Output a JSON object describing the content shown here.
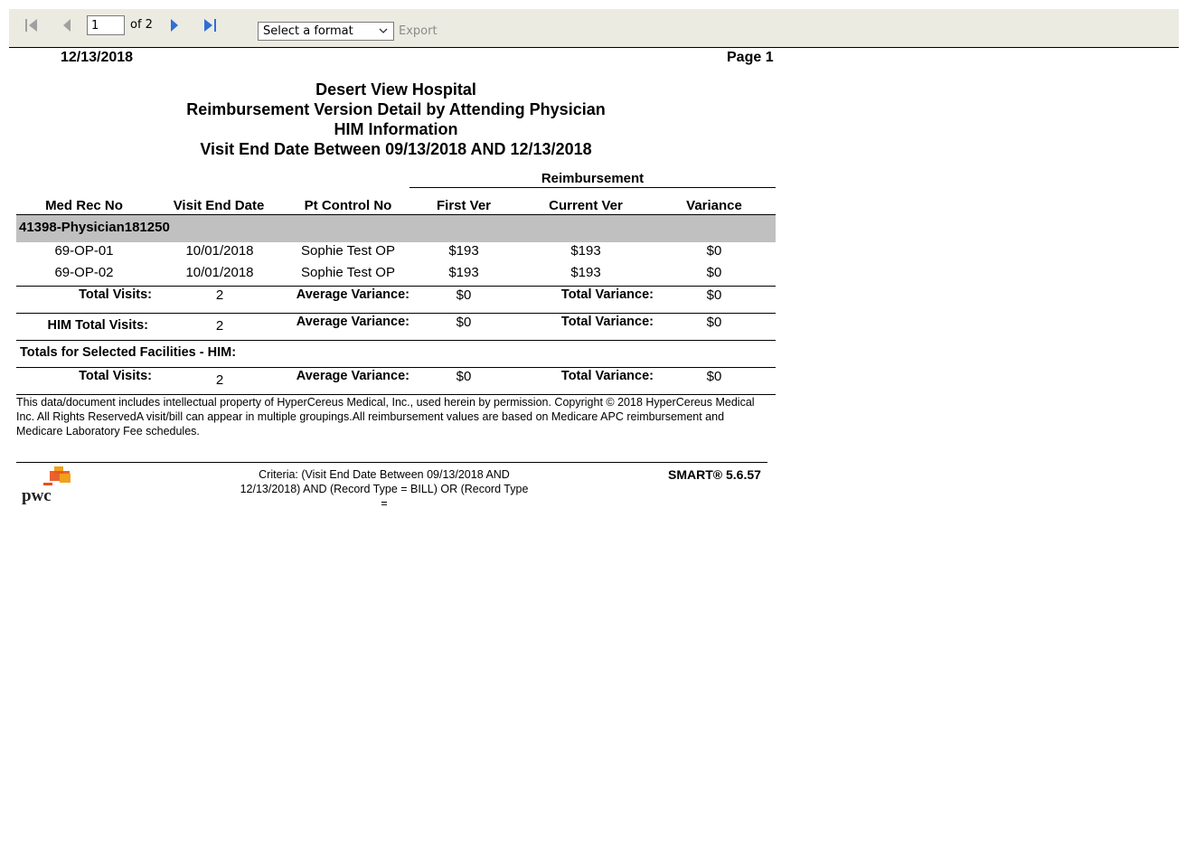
{
  "toolbar": {
    "first_icon": "first-page-icon",
    "prev_icon": "previous-page-icon",
    "page_value": "1",
    "page_of": "of 2",
    "next_icon": "next-page-icon",
    "last_icon": "last-page-icon",
    "format_select": "Select a format",
    "export_label": "Export"
  },
  "report": {
    "date": "12/13/2018",
    "page": "Page 1",
    "titles": [
      "Desert View Hospital",
      "Reimbursement Version Detail by Attending Physician",
      "HIM Information",
      "Visit End Date Between 09/13/2018 AND 12/13/2018"
    ],
    "group_header": "Reimbursement",
    "columns": [
      "Med Rec No",
      "Visit End Date",
      "Pt Control No",
      "First Ver",
      "Current Ver",
      "Variance"
    ],
    "group_label": "41398-Physician181250",
    "rows": [
      [
        "69-OP-01",
        "10/01/2018",
        "Sophie Test OP",
        "$193",
        "$193",
        "$0"
      ],
      [
        "69-OP-02",
        "10/01/2018",
        "Sophie Test OP",
        "$193",
        "$193",
        "$0"
      ]
    ],
    "group_totals": {
      "visits_label": "Total Visits:",
      "visits": "2",
      "avg_label": "Average Variance:",
      "avg": "$0",
      "total_label": "Total Variance:",
      "total": "$0"
    },
    "him_totals": {
      "visits_label": "HIM Total Visits:",
      "visits": "2",
      "avg_label": "Average Variance:",
      "avg": "$0",
      "total_label": "Total Variance:",
      "total": "$0"
    },
    "facilities_label": "Totals for Selected Facilities - HIM:",
    "facility_totals": {
      "visits_label": "Total Visits:",
      "visits": "2",
      "avg_label": "Average Variance:",
      "avg": "$0",
      "total_label": "Total Variance:",
      "total": "$0"
    },
    "disclaimer": "This data/document includes intellectual property of HyperCereus Medical, Inc., used herein by permission. Copyright © 2018 HyperCereus Medical Inc. All Rights ReservedA visit/bill can appear in multiple groupings.All reimbursement values are based on Medicare APC reimbursement and Medicare Laboratory Fee schedules.",
    "criteria": "Criteria: (Visit End Date Between 09/13/2018 AND 12/13/2018) AND (Record Type = BILL) OR (Record Type =",
    "logo_text": "pwc",
    "version": "SMART® 5.6.57"
  },
  "colors": {
    "toolbar_bg": "#ecebe1",
    "group_band": "#c0c0c0",
    "icon_gray": "#a0a0a0",
    "icon_blue": "#2f6fd6",
    "logo_orange": "#e8501a",
    "logo_yellow": "#f0a11b"
  }
}
